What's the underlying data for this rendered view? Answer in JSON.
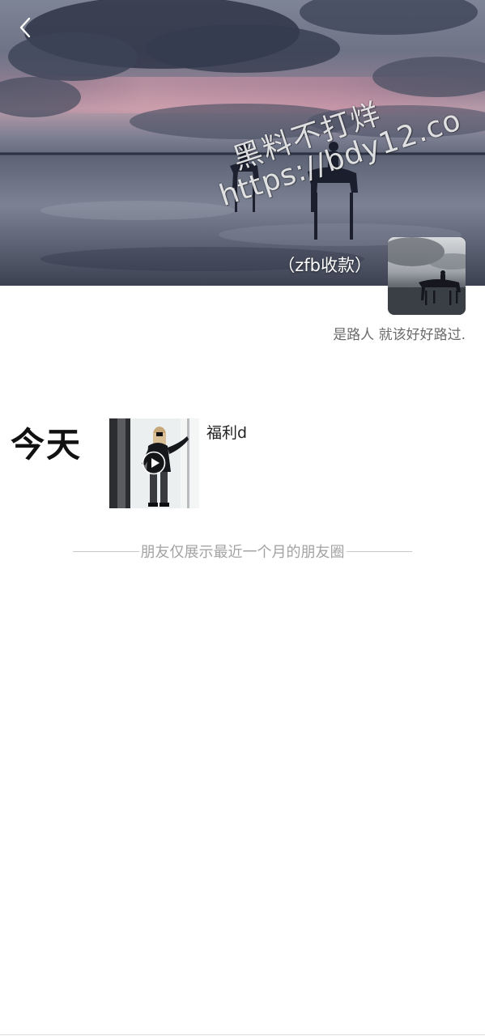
{
  "cover": {
    "watermark_line1": "黑料不打烊",
    "watermark_line2": "https://bdy12.co",
    "nickname": "（zfb收款）"
  },
  "profile": {
    "signature": "是路人 就该好好路过."
  },
  "posts": [
    {
      "date_label": "今天",
      "text": "福利d",
      "media": "video"
    }
  ],
  "footer": {
    "limit_notice": "朋友仅展示最近一个月的朋友圈"
  },
  "icons": {
    "back": "chevron-left-icon",
    "play": "play-icon"
  }
}
